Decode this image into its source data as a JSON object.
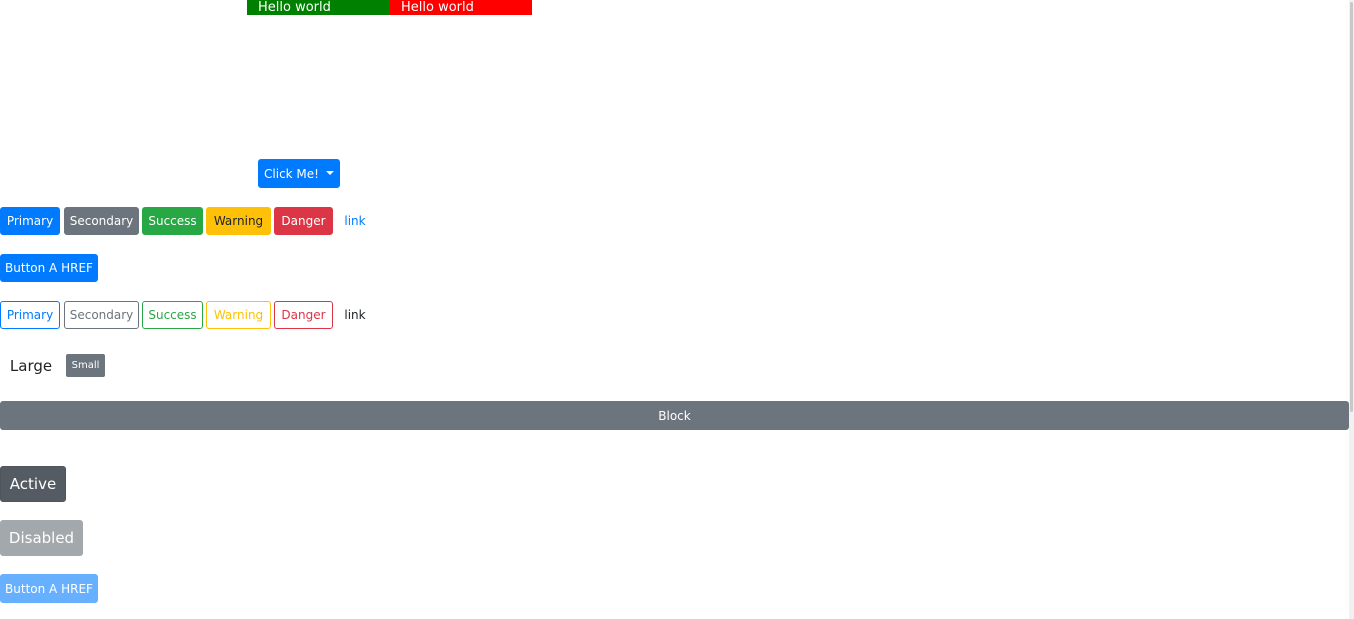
{
  "top_boxes": {
    "green_text": "Hello world",
    "red_text": "Hello world",
    "green_color": "#008000",
    "red_color": "#ff0000"
  },
  "dropdown": {
    "label": "Click Me!"
  },
  "solid_buttons": {
    "primary": "Primary",
    "secondary": "Secondary",
    "success": "Success",
    "warning": "Warning",
    "danger": "Danger",
    "link": "link"
  },
  "anchor_button": {
    "label": "Button A HREF"
  },
  "outline_buttons": {
    "primary": "Primary",
    "secondary": "Secondary",
    "success": "Success",
    "warning": "Warning",
    "danger": "Danger",
    "link": "link"
  },
  "size_buttons": {
    "large": "Large",
    "small": "Small"
  },
  "block_button": {
    "label": "Block"
  },
  "state_buttons": {
    "active": "Active",
    "disabled": "Disabled",
    "anchor_disabled": "Button A HREF"
  },
  "colors": {
    "primary": "#007bff",
    "secondary": "#6c757d",
    "success": "#28a745",
    "warning": "#ffc107",
    "danger": "#dc3545"
  }
}
